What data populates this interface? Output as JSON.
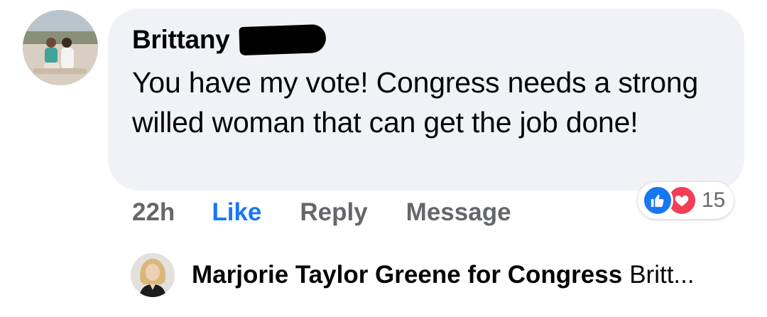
{
  "comment": {
    "author": "Brittany",
    "text": "You have my vote! Congress needs a strong willed woman that can get the job done!",
    "time": "22h",
    "actions": {
      "like": "Like",
      "reply": "Reply",
      "message": "Message"
    },
    "reactions": {
      "icons": [
        "like-icon",
        "love-icon"
      ],
      "count": "15"
    }
  },
  "reply": {
    "author": "Marjorie Taylor Greene for Congress",
    "snippet": "Britt..."
  },
  "colors": {
    "bubble": "#f0f2f5",
    "like_blue": "#1877f2",
    "love_red": "#f33e58",
    "muted": "#65676b"
  }
}
